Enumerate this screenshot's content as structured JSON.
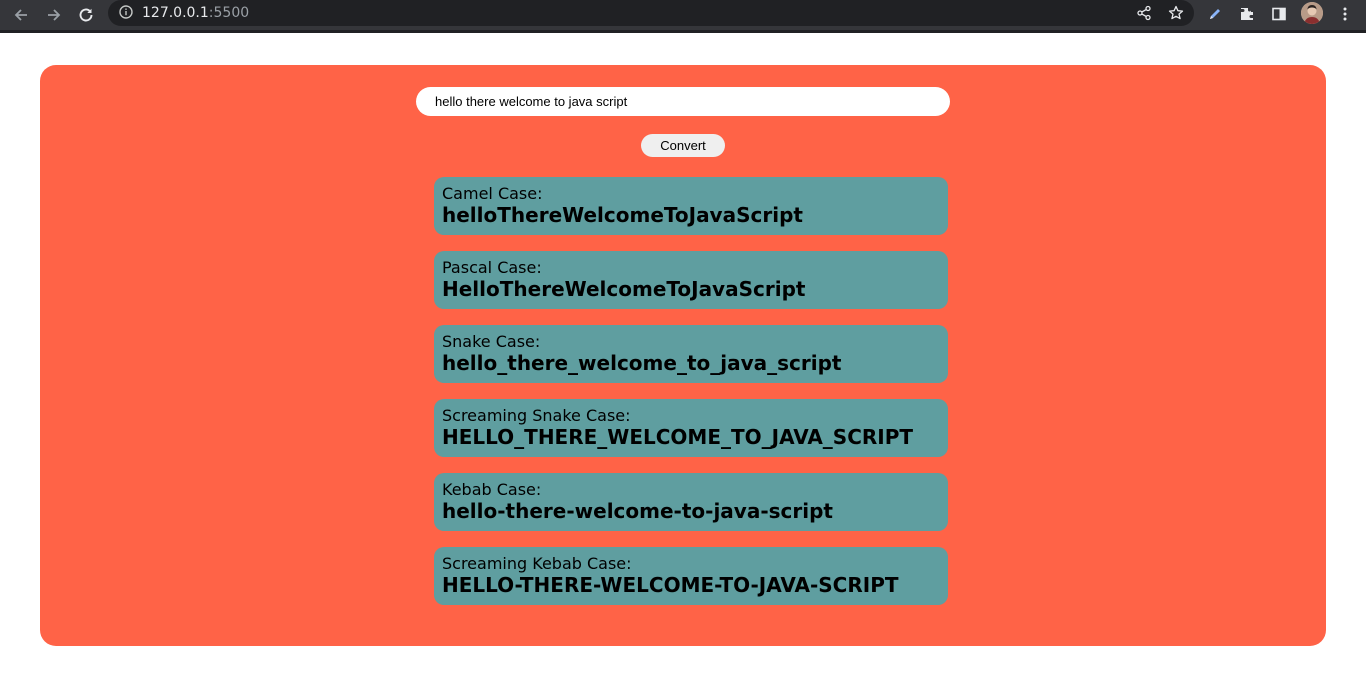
{
  "browser": {
    "url_host": "127.0.0.1",
    "url_port": ":5500"
  },
  "input": {
    "value": "hello there welcome to java script"
  },
  "convert_label": "Convert",
  "results": [
    {
      "label": "Camel Case:",
      "value": "helloThereWelcomeToJavaScript"
    },
    {
      "label": "Pascal Case:",
      "value": "HelloThereWelcomeToJavaScript"
    },
    {
      "label": "Snake Case:",
      "value": "hello_there_welcome_to_java_script"
    },
    {
      "label": "Screaming Snake Case:",
      "value": "HELLO_THERE_WELCOME_TO_JAVA_SCRIPT"
    },
    {
      "label": "Kebab Case:",
      "value": "hello-there-welcome-to-java-script"
    },
    {
      "label": "Screaming Kebab Case:",
      "value": "HELLO-THERE-WELCOME-TO-JAVA-SCRIPT"
    }
  ],
  "colors": {
    "panel": "#ff6347",
    "card": "#5f9ea0",
    "chrome_bar": "#35363a"
  },
  "icons": [
    "back-icon",
    "forward-icon",
    "reload-icon",
    "info-icon",
    "share-icon",
    "star-icon",
    "pen-icon",
    "extensions-icon",
    "side-panel-icon",
    "avatar",
    "menu-icon"
  ]
}
